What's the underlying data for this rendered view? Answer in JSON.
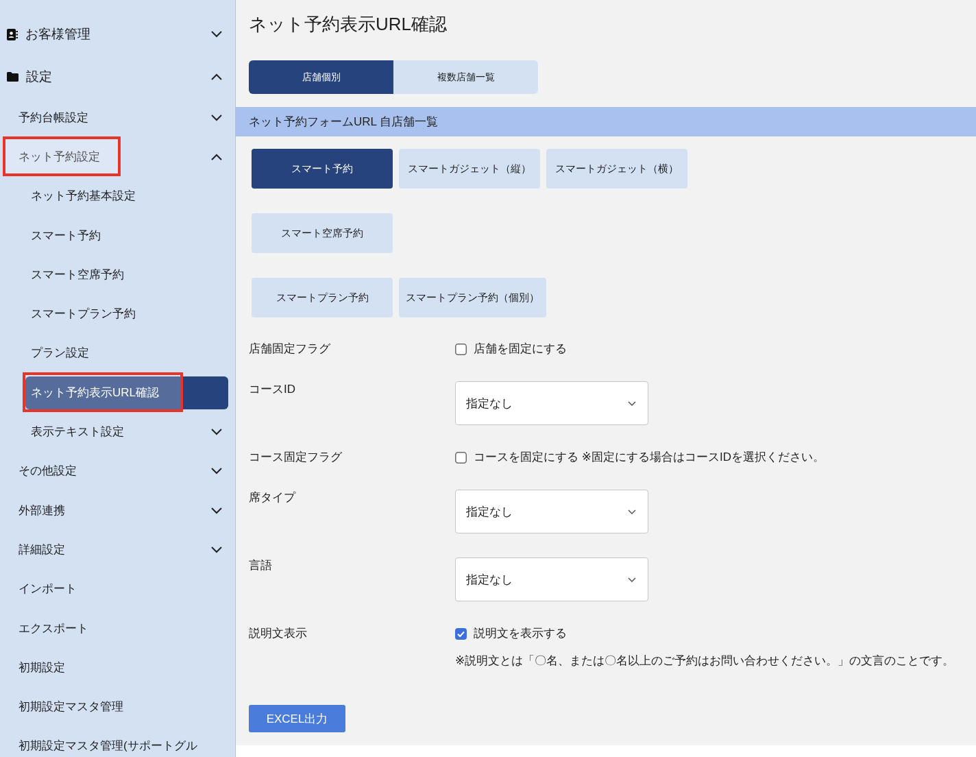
{
  "sidebar": {
    "items": [
      {
        "label": "お客様管理",
        "selected": false,
        "highlighted": false,
        "expanded": false
      },
      {
        "label": "設定",
        "selected": false,
        "highlighted": false,
        "expanded": true,
        "children": [
          {
            "label": "予約台帳設定",
            "selected": false,
            "highlighted": false,
            "expanded": false
          },
          {
            "label": "ネット予約設定",
            "selected": false,
            "highlighted": true,
            "expanded": true,
            "children": [
              {
                "label": "ネット予約基本設定",
                "selected": false,
                "highlighted": false
              },
              {
                "label": "スマート予約",
                "selected": false,
                "highlighted": false
              },
              {
                "label": "スマート空席予約",
                "selected": false,
                "highlighted": false
              },
              {
                "label": "スマートプラン予約",
                "selected": false,
                "highlighted": false
              },
              {
                "label": "プラン設定",
                "selected": false,
                "highlighted": false
              },
              {
                "label": "ネット予約表示URL確認",
                "selected": true,
                "highlighted": true
              },
              {
                "label": "表示テキスト設定",
                "selected": false,
                "highlighted": false,
                "expanded": false
              }
            ]
          },
          {
            "label": "その他設定",
            "selected": false,
            "highlighted": false,
            "expanded": false
          },
          {
            "label": "外部連携",
            "selected": false,
            "highlighted": false,
            "expanded": false
          },
          {
            "label": "詳細設定",
            "selected": false,
            "highlighted": false,
            "expanded": false
          },
          {
            "label": "インポート",
            "selected": false,
            "highlighted": false
          },
          {
            "label": "エクスポート",
            "selected": false,
            "highlighted": false
          },
          {
            "label": "初期設定",
            "selected": false,
            "highlighted": false
          },
          {
            "label": "初期設定マスタ管理",
            "selected": false,
            "highlighted": false
          },
          {
            "label": "初期設定マスタ管理(サポートグル",
            "selected": false,
            "highlighted": false
          }
        ]
      }
    ]
  },
  "page": {
    "title": "ネット予約表示URL確認"
  },
  "tabs": [
    {
      "label": "店舗個別",
      "selected": true
    },
    {
      "label": "複数店舗一覧",
      "selected": false
    }
  ],
  "section": {
    "title": "ネット予約フォームURL 自店舗一覧"
  },
  "form_types": [
    {
      "buttons": [
        {
          "label": "スマート予約",
          "selected": true
        },
        {
          "label": "スマートガジェット（縦）",
          "selected": false
        },
        {
          "label": "スマートガジェット（横）",
          "selected": false
        }
      ]
    },
    {
      "buttons": [
        {
          "label": "スマート空席予約",
          "selected": false
        }
      ]
    },
    {
      "buttons": [
        {
          "label": "スマートプラン予約",
          "selected": false
        },
        {
          "label": "スマートプラン予約（個別）",
          "selected": false
        }
      ]
    }
  ],
  "fields": [
    {
      "kind": "checkbox",
      "label": "店舗固定フラグ",
      "option": "店舗を固定にする",
      "checked": false
    },
    {
      "kind": "select",
      "label": "コースID",
      "value": "指定なし"
    },
    {
      "kind": "checkbox",
      "label": "コース固定フラグ",
      "option": "コースを固定にする ※固定にする場合はコースIDを選択ください。",
      "checked": false
    },
    {
      "kind": "select",
      "label": "席タイプ",
      "value": "指定なし"
    },
    {
      "kind": "select",
      "label": "言語",
      "value": "指定なし"
    },
    {
      "kind": "checkbox",
      "label": "説明文表示",
      "option": "説明文を表示する",
      "checked": true,
      "note": "※説明文とは「〇名、または〇名以上のご予約はお問い合わせください。」の文言のことです。"
    }
  ],
  "export_button": "EXCEL出力"
}
